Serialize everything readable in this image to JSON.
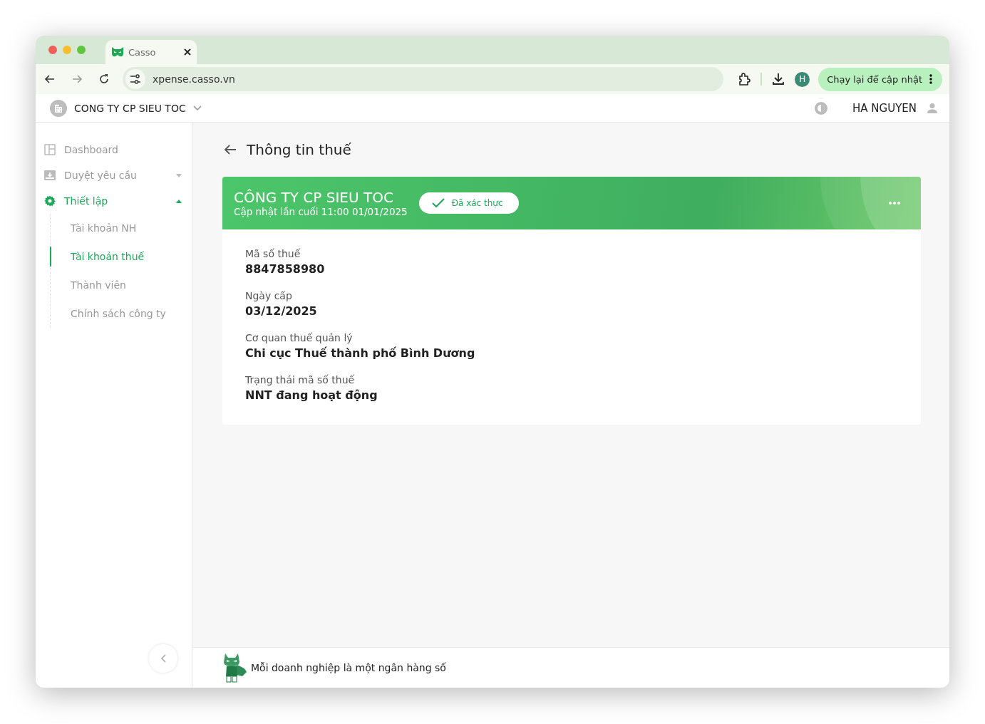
{
  "browser": {
    "tab_title": "Casso",
    "back_enabled": true,
    "forward_enabled": false,
    "url": "xpense.casso.vn",
    "avatar": "H",
    "update_button": "Chạy lại để cập nhật"
  },
  "app_header": {
    "company": "CONG TY CP SIEU TOC",
    "user": "HA NGUYEN"
  },
  "sidebar": {
    "items": [
      {
        "label": "Dashboard",
        "selected": false
      },
      {
        "label": "Duyệt yêu cầu",
        "selected": false,
        "expanded": false
      },
      {
        "label": "Thiết lập",
        "selected": true,
        "expanded": true,
        "children": [
          {
            "label": "Tài khoản NH",
            "selected": false
          },
          {
            "label": "Tài khoản thuế",
            "selected": true
          },
          {
            "label": "Thành viên",
            "selected": false
          },
          {
            "label": "Chính sách công ty",
            "selected": false
          }
        ]
      }
    ]
  },
  "page": {
    "title": "Thông tin thuế",
    "card": {
      "company": "CÔNG TY CP SIEU TOC",
      "updated": "Cập nhật lần cuối 11:00 01/01/2025",
      "verified": true,
      "badge": "Đã xác thực",
      "fields": [
        {
          "label": "Mã số thuế",
          "value": "8847858980"
        },
        {
          "label": "Ngày cấp",
          "value": "03/12/2025"
        },
        {
          "label": "Cơ quan thuế quản lý",
          "value": "Chi cục Thuế thành phố Bình Dương"
        },
        {
          "label": "Trạng thái mã số thuế",
          "value": "NNT đang hoạt động"
        }
      ]
    }
  },
  "footer": {
    "slogan": "Mỗi doanh nghiệp là một ngân hàng số"
  }
}
